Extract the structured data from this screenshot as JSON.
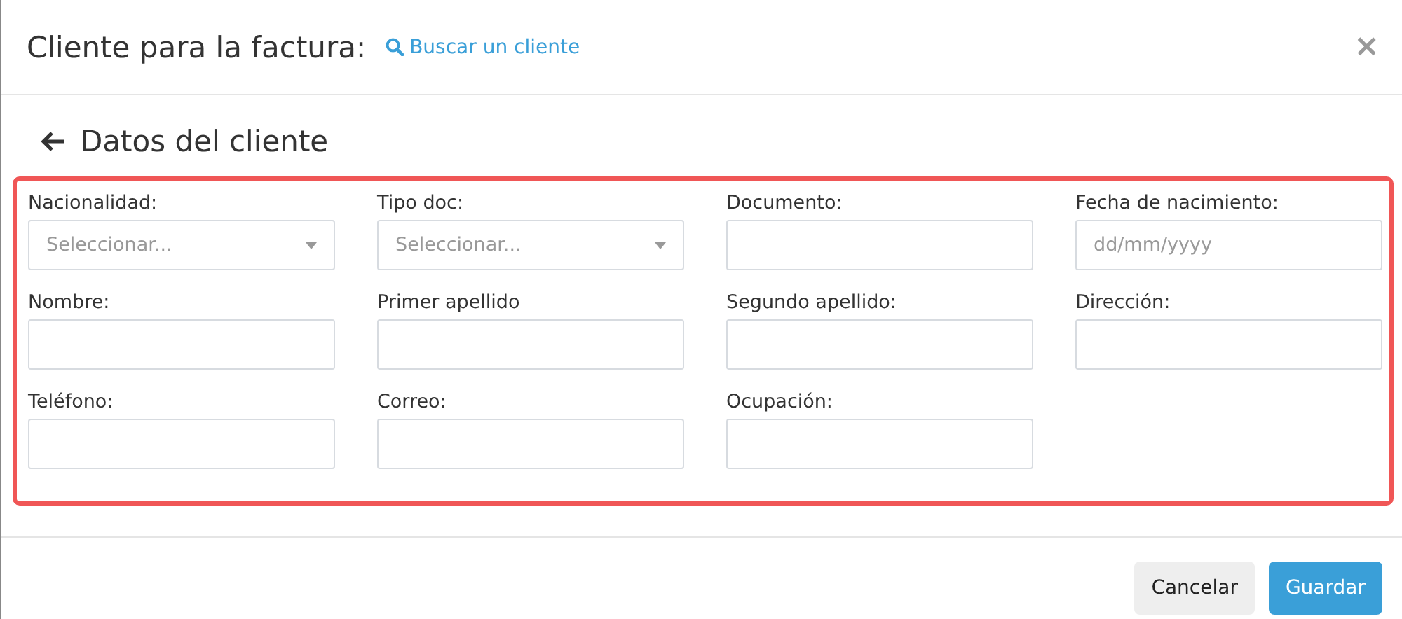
{
  "header": {
    "title": "Cliente para la factura:",
    "search_link": "Buscar un cliente",
    "close": "×"
  },
  "section": {
    "title": "Datos del cliente"
  },
  "fields": [
    {
      "label": "Nacionalidad:",
      "kind": "select",
      "placeholder": "Seleccionar..."
    },
    {
      "label": "Tipo doc:",
      "kind": "select",
      "placeholder": "Seleccionar..."
    },
    {
      "label": "Documento:",
      "kind": "text"
    },
    {
      "label": "Fecha de nacimiento:",
      "kind": "text",
      "placeholder": "dd/mm/yyyy"
    },
    {
      "label": "Nombre:",
      "kind": "text"
    },
    {
      "label": "Primer apellido",
      "kind": "text"
    },
    {
      "label": "Segundo apellido:",
      "kind": "text"
    },
    {
      "label": "Dirección:",
      "kind": "text"
    },
    {
      "label": "Teléfono:",
      "kind": "text"
    },
    {
      "label": "Correo:",
      "kind": "text"
    },
    {
      "label": "Ocupación:",
      "kind": "text"
    }
  ],
  "buttons": [
    {
      "label": "Cancelar",
      "kind": "secondary"
    },
    {
      "label": "Guardar",
      "kind": "primary"
    }
  ]
}
